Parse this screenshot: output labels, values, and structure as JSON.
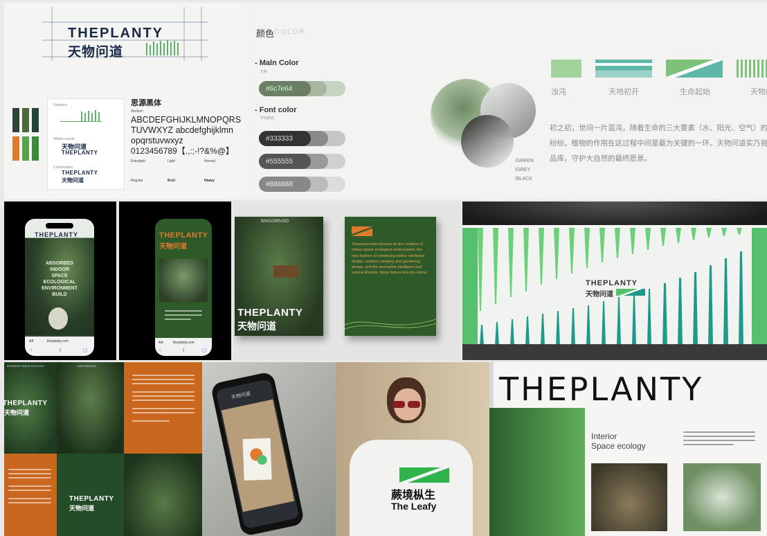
{
  "logo_panel": {
    "wordmark": "THEPLANTY",
    "cn_name": "天物问道",
    "font_title": "思源黑体",
    "font_weight_label": "Medium",
    "glyphs_line1": "ABCDEFGHIJKLMNOPQRS",
    "glyphs_line2": "TUVWXYZ abcdefghijklmn",
    "glyphs_line3": "opqrstuvwxyz",
    "glyphs_line4": "0123456789【.,:;-!?&%@】",
    "weights": [
      "Extralight",
      "Light",
      "Normal",
      "Regular",
      "Bold",
      "Heavy"
    ],
    "card_labels": [
      "Graphics",
      "Written words",
      "Combination"
    ],
    "swatch_colors": [
      "#2e4436",
      "#6b8a3c",
      "#234a3b",
      "#e07a2c",
      "#57a44a",
      "#3d8a3f"
    ]
  },
  "color_panel": {
    "title_cn": "颜色",
    "title_en": "COLOR.",
    "main_color_label": "Maln Color",
    "main_color_sub": "主色",
    "main_color_hex": "#6c7e64",
    "font_color_label": "Font color",
    "font_color_sub": "字体颜色",
    "font_color_hexes": [
      "#333333",
      "#555555",
      "#888888"
    ],
    "circle_labels": [
      "/GREEN",
      "/GREY",
      "/BLACK"
    ],
    "strip_labels": [
      "浊沌",
      "天地初开",
      "生命起始",
      "天物问"
    ],
    "paragraph_line1": "初之初，世间一片混沌，随着生命的三大要素（水、阳光、空气）的产生，世",
    "paragraph_line2": "纷纷。植物的作用在这过程中间是最为关键的一环。天物问道实乃我们期",
    "paragraph_line3": "品库，守护大自然的最终愿景。"
  },
  "phones_row": {
    "phone1_brand": "THEPLANTY",
    "phone1_lines": [
      "ABSORBED",
      "INDOOR",
      "SPACE",
      "ECOLOGICAL",
      "ENVIRONMENT",
      "BUILD"
    ],
    "phone1_url": "theplanty.com",
    "phone2_brand": "THEPLANTY",
    "phone2_cn": "天物问道",
    "phone2_url": "theplanty.com",
    "browser_aa": "AA"
  },
  "book_panel": {
    "publisher": "BINGOBRAND",
    "cover_wordmark": "THEPLANTY",
    "cover_cn": "天物问道",
    "back_text": "Tianwuwendao focuses on the creation of indoor space ecological environment, the new fashion of combining indoor rainforest design, outdoor camping and gardening design, and the innovative intelligent and natural lifestyle. Move Nature into the Home"
  },
  "wall_panel": {
    "wordmark": "THEPLANTY",
    "cn_name": "天物问道"
  },
  "poster_panel": {
    "brand": "THEPLANTY",
    "cn": "天物问道",
    "publisher": "BINGOBRAND",
    "small_caption": "INTERIOR SPACE ECOLOGY"
  },
  "phone_hand_panel": {
    "title": "天物问道"
  },
  "tshirt_panel": {
    "cn": "蕨境枞生",
    "en": "The Leafy"
  },
  "brochure_panel": {
    "wordmark": "THEPLANTY",
    "heading_line1": "Interior",
    "heading_line2": "Space ecology"
  }
}
